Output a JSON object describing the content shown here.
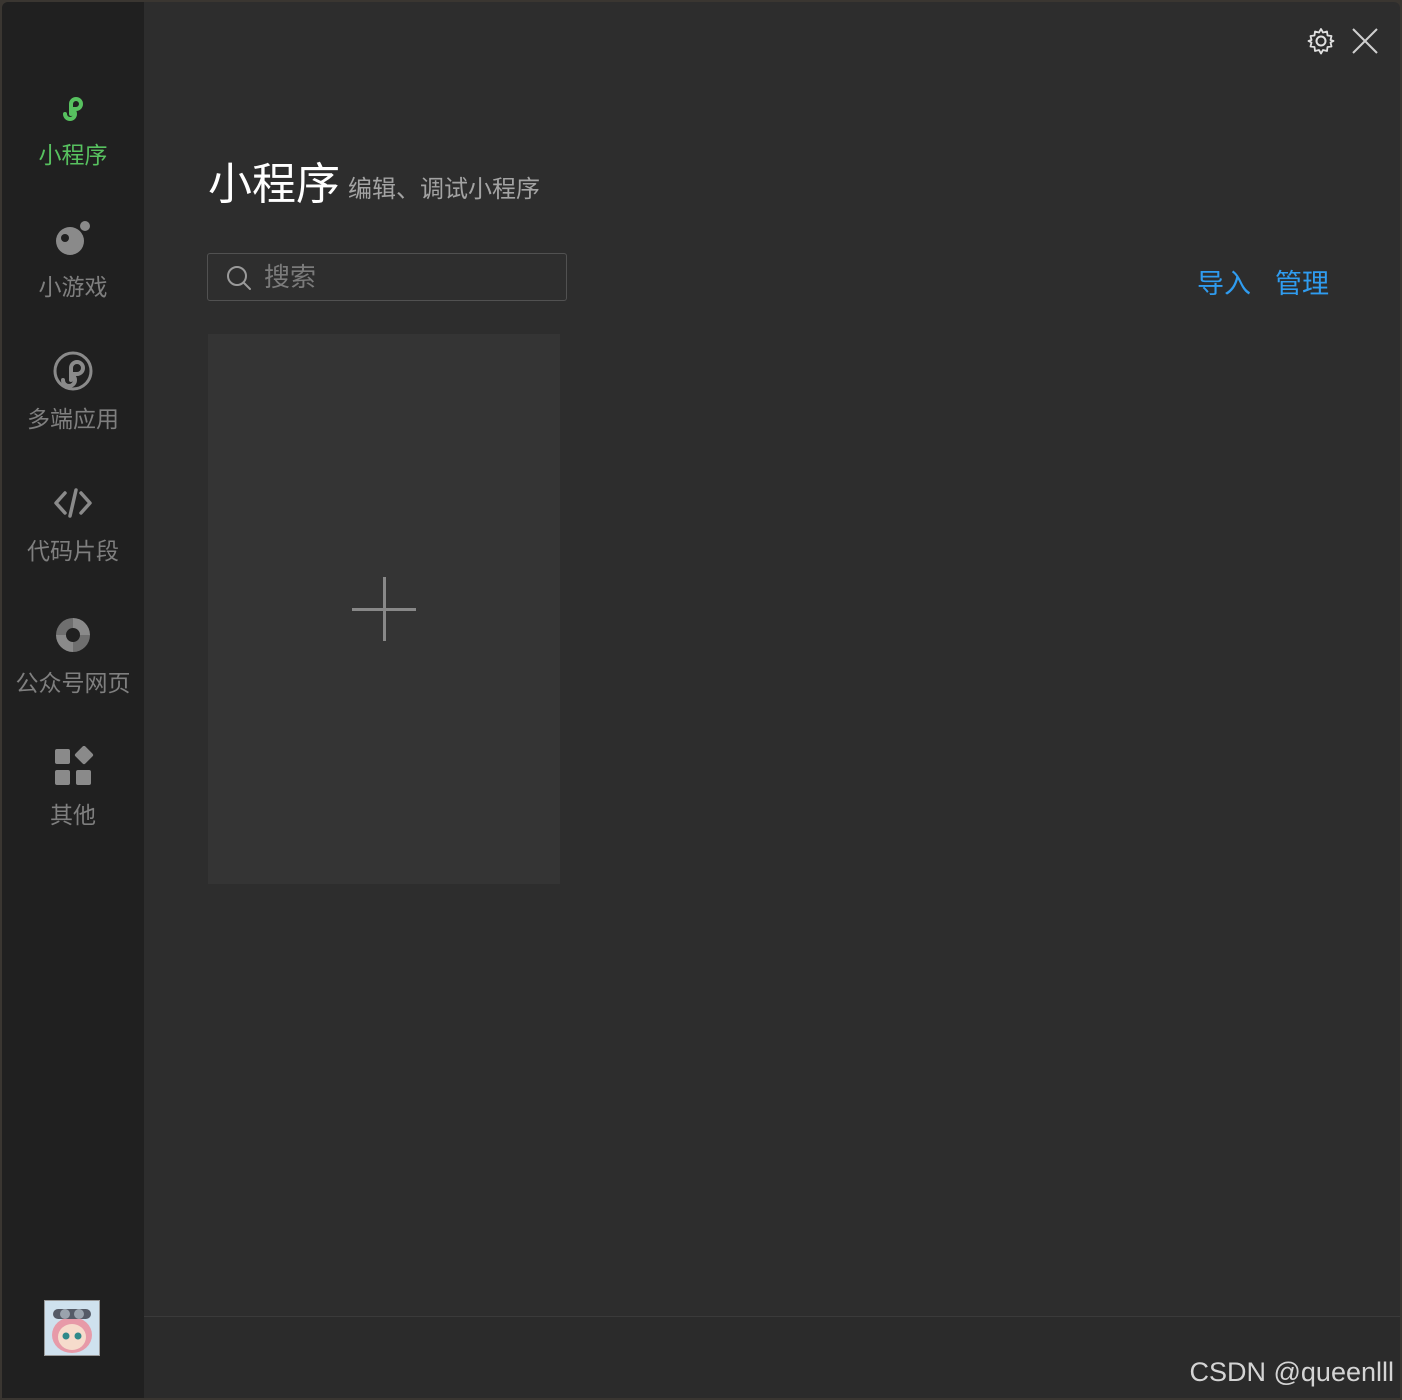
{
  "sidebar": {
    "items": [
      {
        "label": "小程序",
        "icon": "miniprogram-icon",
        "active": true
      },
      {
        "label": "小游戏",
        "icon": "minigame-icon",
        "active": false
      },
      {
        "label": "多端应用",
        "icon": "multiplatform-icon",
        "active": false
      },
      {
        "label": "代码片段",
        "icon": "code-icon",
        "active": false
      },
      {
        "label": "公众号网页",
        "icon": "official-account-icon",
        "active": false
      },
      {
        "label": "其他",
        "icon": "other-grid-icon",
        "active": false
      }
    ],
    "active_color": "#57c15f",
    "inactive_color": "#7f7f7f"
  },
  "header": {
    "title": "小程序",
    "subtitle": "编辑、调试小程序"
  },
  "search": {
    "placeholder": "搜索",
    "value": ""
  },
  "actions": {
    "import_label": "导入",
    "manage_label": "管理",
    "link_color": "#2f9cf0"
  },
  "new_project": {
    "icon": "plus-icon"
  },
  "watermark": "CSDN @queenlll"
}
